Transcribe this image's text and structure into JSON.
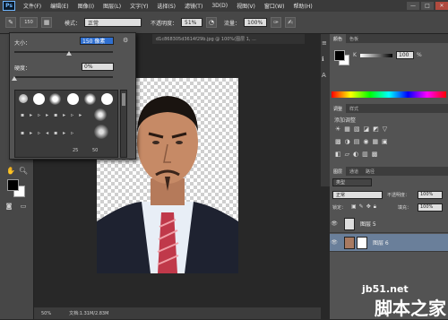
{
  "app": {
    "logo_text": "Ps"
  },
  "menu": {
    "items": [
      "文件(F)",
      "编辑(E)",
      "图像(I)",
      "图层(L)",
      "文字(Y)",
      "选择(S)",
      "滤镜(T)",
      "3D(D)",
      "视图(V)",
      "窗口(W)",
      "帮助(H)"
    ]
  },
  "window_controls": {
    "minimize": "—",
    "maximize": "□",
    "close": "✕"
  },
  "options_bar": {
    "brush_size": "150",
    "mode_label": "模式：",
    "mode_value": "正常",
    "opacity_label": "不透明度：",
    "opacity_value": "51%",
    "flow_label": "流量：",
    "flow_value": "100%"
  },
  "brush_panel": {
    "size_label": "大小：",
    "size_value": "150 像素",
    "hardness_label": "硬度：",
    "hardness_value": "0%",
    "size_fraction": 0.55,
    "hardness_fraction": 0.0,
    "tip_sizes": [
      "25",
      "50"
    ]
  },
  "document": {
    "tab_title": "d1c868305d3614f29b.jpg @ 100%(图层 1, ...",
    "zoom": "50%",
    "doc_info": "文档:1.31M/2.83M"
  },
  "color_panel": {
    "tabs": [
      "颜色",
      "色板"
    ],
    "channel_label": "K",
    "channel_value": "100",
    "percent": "%"
  },
  "adjustments_panel": {
    "tabs": [
      "调整",
      "样式"
    ],
    "title": "添加调整"
  },
  "layers_panel": {
    "tabs": [
      "图层",
      "通道",
      "路径"
    ],
    "filter_label": "类型",
    "blend_mode": "正常",
    "opacity_label": "不透明度：",
    "opacity_value": "100%",
    "lock_label": "锁定：",
    "fill_label": "填充：",
    "fill_value": "100%",
    "layers": [
      {
        "name": "图层 5",
        "selected": false
      },
      {
        "name": "图层 6",
        "selected": true
      }
    ]
  },
  "watermark": {
    "line1": "jb51.net",
    "line2": "脚本之家"
  },
  "colors": {
    "accent": "#6fb6ff",
    "foreground": "#000000",
    "background": "#ffffff"
  }
}
